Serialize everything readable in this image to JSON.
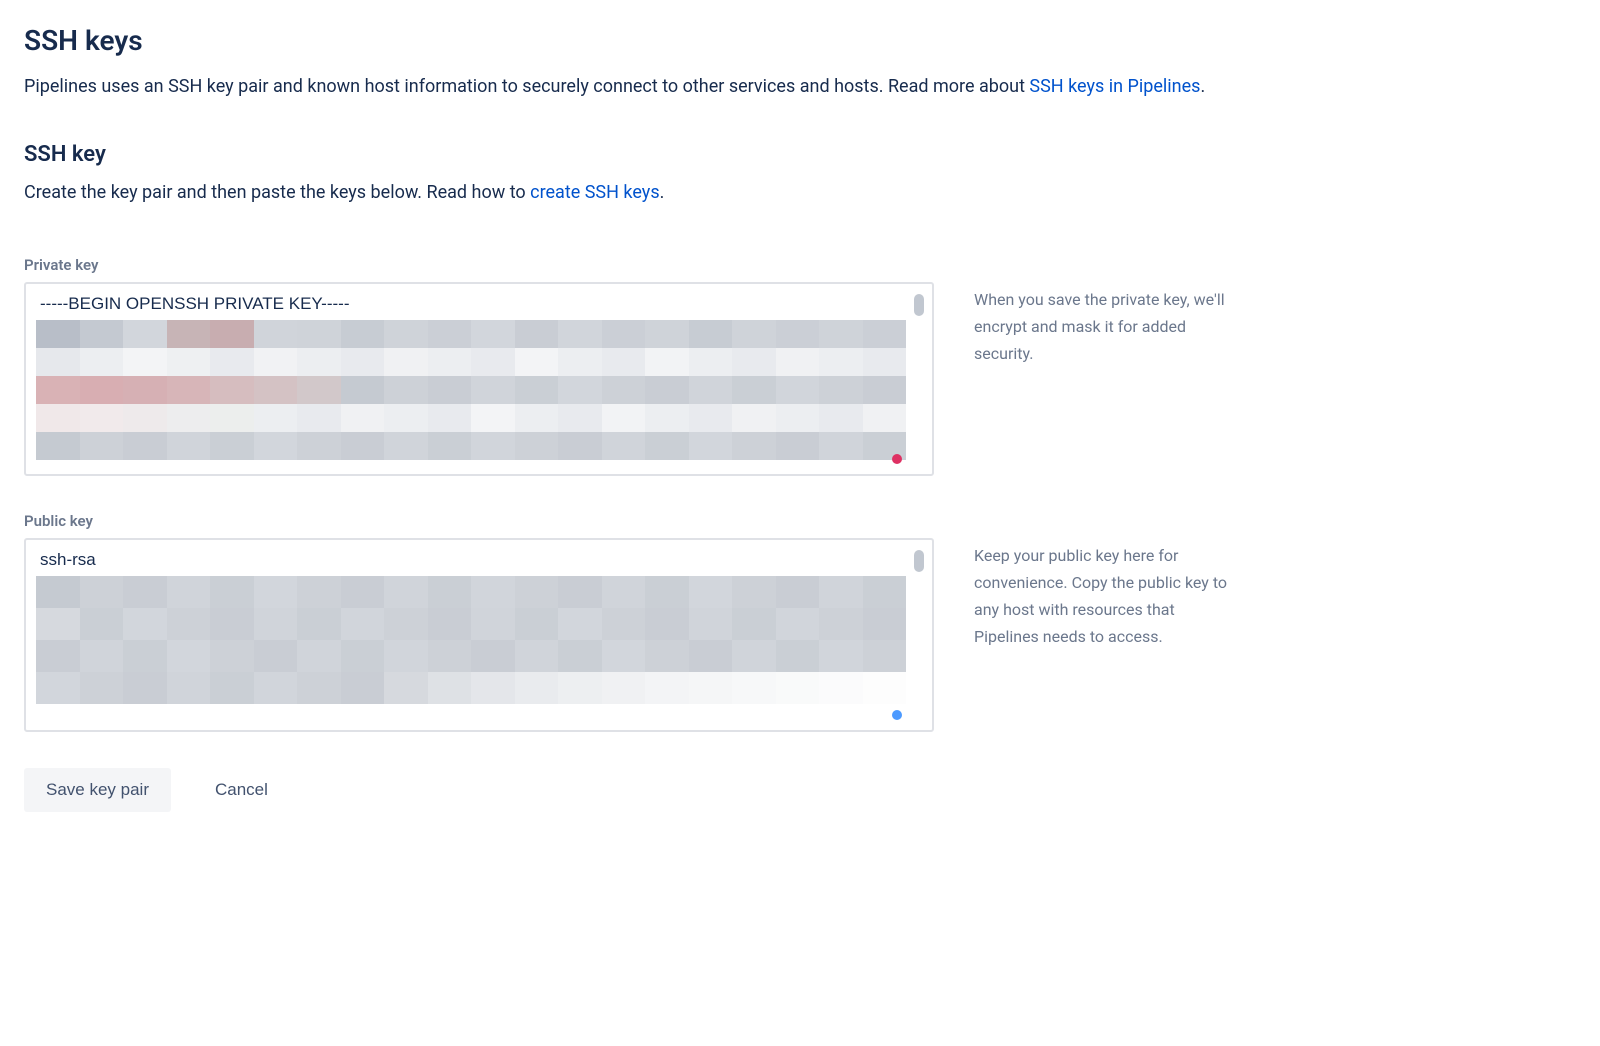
{
  "page": {
    "title": "SSH keys",
    "description_before_link": "Pipelines uses an SSH key pair and known host information to securely connect to other services and hosts. Read more about ",
    "description_link_text": "SSH keys in Pipelines",
    "description_after_link": "."
  },
  "section": {
    "heading": "SSH key",
    "desc_before_link": "Create the key pair and then paste the keys below. Read how to ",
    "desc_link_text": "create SSH keys",
    "desc_after_link": "."
  },
  "private_key": {
    "label": "Private key",
    "first_line": "-----BEGIN OPENSSH PRIVATE KEY-----",
    "help": "When you save the private key, we'll encrypt and mask it for added security."
  },
  "public_key": {
    "label": "Public key",
    "first_line": "ssh-rsa",
    "help": "Keep your public key here for convenience. Copy the public key to any host with resources that Pipelines needs to access."
  },
  "buttons": {
    "save": "Save key pair",
    "cancel": "Cancel"
  }
}
